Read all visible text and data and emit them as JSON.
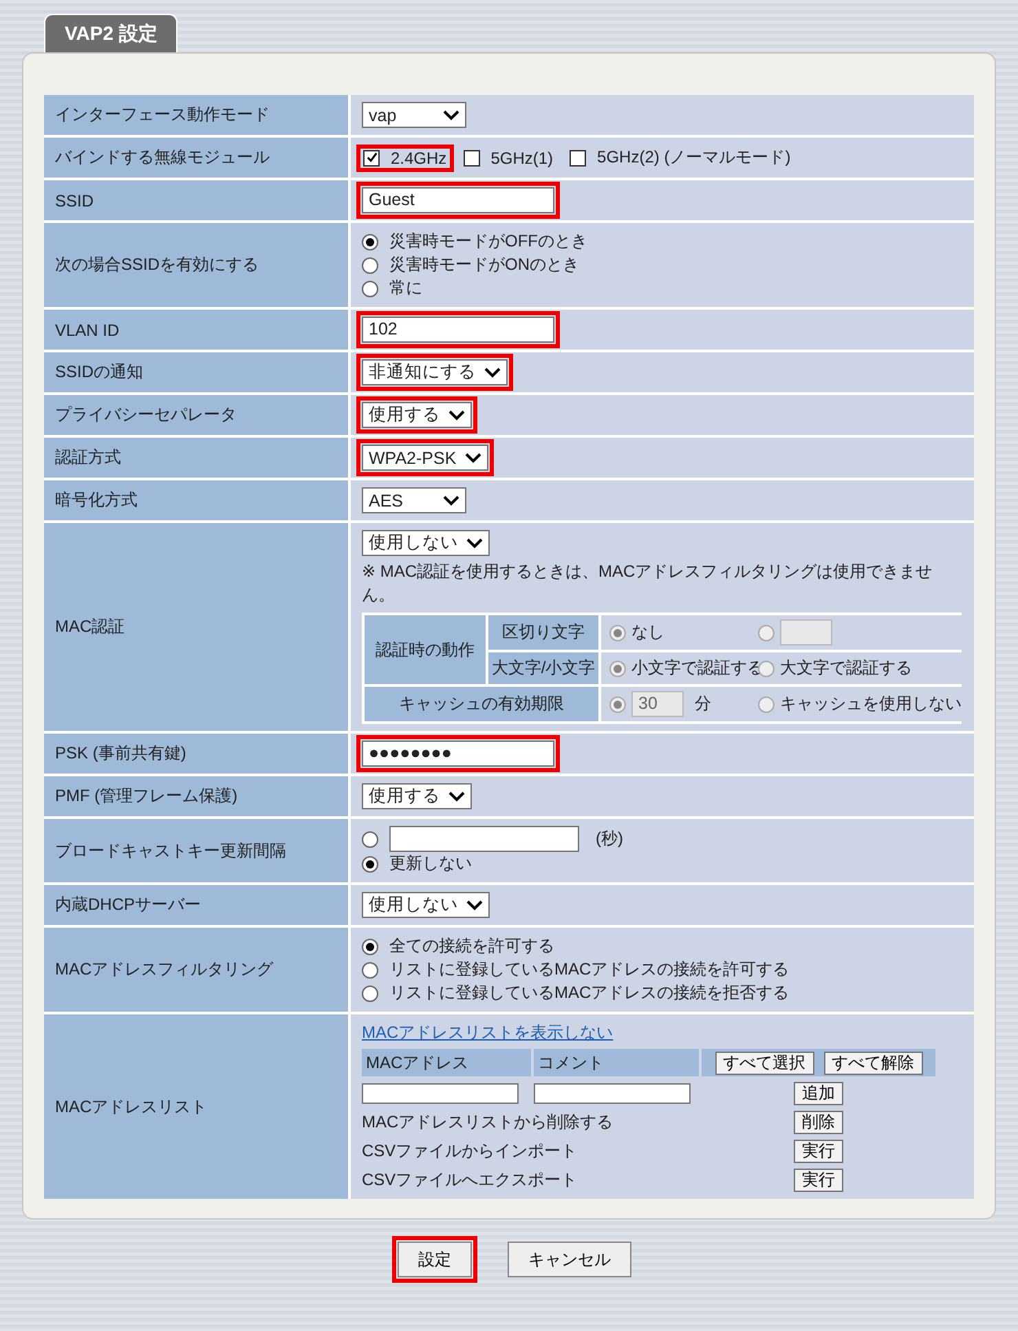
{
  "title": "VAP2 設定",
  "rows": [
    {
      "label": "インターフェース動作モード",
      "kind": "select",
      "value": "vap",
      "highlighted": false
    },
    {
      "label": "バインドする無線モジュール",
      "kind": "checkboxes",
      "options": [
        {
          "label": "2.4GHz",
          "checked": true,
          "highlighted": true
        },
        {
          "label": "5GHz(1)",
          "checked": false,
          "highlighted": false
        },
        {
          "label": "5GHz(2) (ノーマルモード)",
          "checked": false,
          "highlighted": false
        }
      ]
    },
    {
      "label": "SSID",
      "kind": "text",
      "value": "Guest",
      "highlighted": true
    },
    {
      "label": "次の場合SSIDを有効にする",
      "kind": "radios",
      "options": [
        {
          "kind": "label",
          "label": "災害時モードがOFFのとき",
          "selected": true
        },
        {
          "kind": "label",
          "label": "災害時モードがONのとき",
          "selected": false
        },
        {
          "kind": "label",
          "label": "常に",
          "selected": false
        }
      ]
    },
    {
      "label": "VLAN ID",
      "kind": "text",
      "value": "102",
      "highlighted": true
    },
    {
      "label": "SSIDの通知",
      "kind": "select",
      "value": "非通知にする",
      "highlighted": true
    },
    {
      "label": "プライバシーセパレータ",
      "kind": "select",
      "value": "使用する",
      "highlighted": true
    },
    {
      "label": "認証方式",
      "kind": "select",
      "value": "WPA2-PSK",
      "highlighted": true
    },
    {
      "label": "暗号化方式",
      "kind": "select",
      "value": "AES",
      "highlighted": false
    },
    {
      "label": "MAC認証",
      "kind": "mac_auth",
      "value": "使用しない",
      "note": "※ MAC認証を使用するときは、MACアドレスフィルタリングは使用できません。",
      "group": "認証時の動作",
      "disabled": true,
      "settings": [
        {
          "label": "区切り文字",
          "options": [
            {
              "kind": "label",
              "label": "なし",
              "selected": true
            },
            {
              "kind": "input",
              "selected": false
            }
          ]
        },
        {
          "label": "大文字/小文字",
          "options": [
            {
              "kind": "label",
              "label": "小文字で認証する",
              "selected": true
            },
            {
              "kind": "label",
              "label": "大文字で認証する",
              "selected": false
            }
          ]
        }
      ],
      "cache": {
        "label": "キャッシュの有効期限",
        "options": [
          {
            "kind": "input",
            "value": "30",
            "unit": "分",
            "selected": true
          },
          {
            "kind": "label",
            "label": "キャッシュを使用しない",
            "selected": false
          }
        ]
      }
    },
    {
      "label": "PSK (事前共有鍵)",
      "kind": "text",
      "value": "●●●●●●●●",
      "highlighted": true
    },
    {
      "label": "PMF (管理フレーム保護)",
      "kind": "select",
      "value": "使用する",
      "highlighted": false
    },
    {
      "label": "ブロードキャストキー更新間隔",
      "kind": "radios",
      "options": [
        {
          "kind": "input",
          "unit": "(秒)",
          "selected": false
        },
        {
          "kind": "label",
          "label": "更新しない",
          "selected": true
        }
      ]
    },
    {
      "label": "内蔵DHCPサーバー",
      "kind": "select",
      "value": "使用しない",
      "highlighted": false
    },
    {
      "label": "MACアドレスフィルタリング",
      "kind": "radios",
      "options": [
        {
          "kind": "label",
          "label": "全ての接続を許可する",
          "selected": true
        },
        {
          "kind": "label",
          "label": "リストに登録しているMACアドレスの接続を許可する",
          "selected": false
        },
        {
          "kind": "label",
          "label": "リストに登録しているMACアドレスの接続を拒否する",
          "selected": false
        }
      ]
    },
    {
      "label": "MACアドレスリスト",
      "kind": "mac_list",
      "link": "MACアドレスリストを表示しない",
      "columns": [
        "MACアドレス",
        "コメント"
      ],
      "header_buttons": [
        "すべて選択",
        "すべて解除"
      ],
      "add_button": "追加",
      "actions": [
        {
          "label": "MACアドレスリストから削除する",
          "button": "削除"
        },
        {
          "label": "CSVファイルからインポート",
          "button": "実行"
        },
        {
          "label": "CSVファイルへエクスポート",
          "button": "実行"
        }
      ]
    }
  ],
  "buttons": [
    {
      "label": "設定",
      "highlighted": true
    },
    {
      "label": "キャンセル",
      "highlighted": false
    }
  ]
}
